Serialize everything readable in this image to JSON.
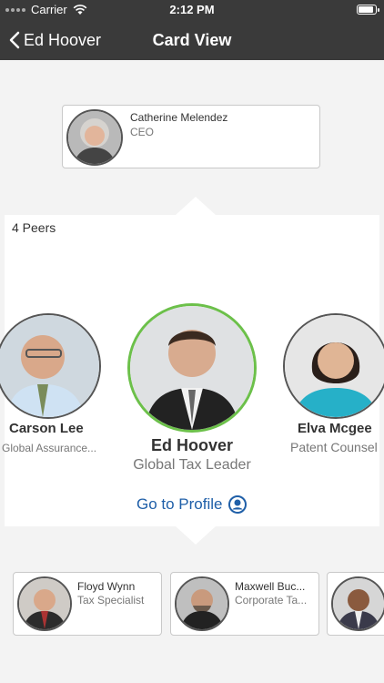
{
  "status_bar": {
    "carrier": "Carrier",
    "time": "2:12 PM",
    "battery_level": 0.95
  },
  "nav": {
    "back_label": "Ed Hoover",
    "title": "Card View"
  },
  "manager": {
    "name": "Catherine Melendez",
    "title": "CEO"
  },
  "peers": {
    "count_label": "4 Peers",
    "left": {
      "name": "Carson Lee",
      "title": "Global Assurance..."
    },
    "center": {
      "name": "Ed Hoover",
      "title": "Global Tax Leader"
    },
    "right": {
      "name": "Elva Mcgee",
      "title": "Patent Counsel"
    },
    "go_to_profile": "Go to Profile"
  },
  "reports": [
    {
      "name": "Floyd Wynn",
      "title": "Tax Specialist"
    },
    {
      "name": "Maxwell Buc...",
      "title": "Corporate Ta..."
    },
    {
      "name": "",
      "title": ""
    }
  ],
  "colors": {
    "nav_background": "#3a3a3a",
    "selected_ring": "#6cc04a",
    "link_blue": "#1f5fa8"
  }
}
